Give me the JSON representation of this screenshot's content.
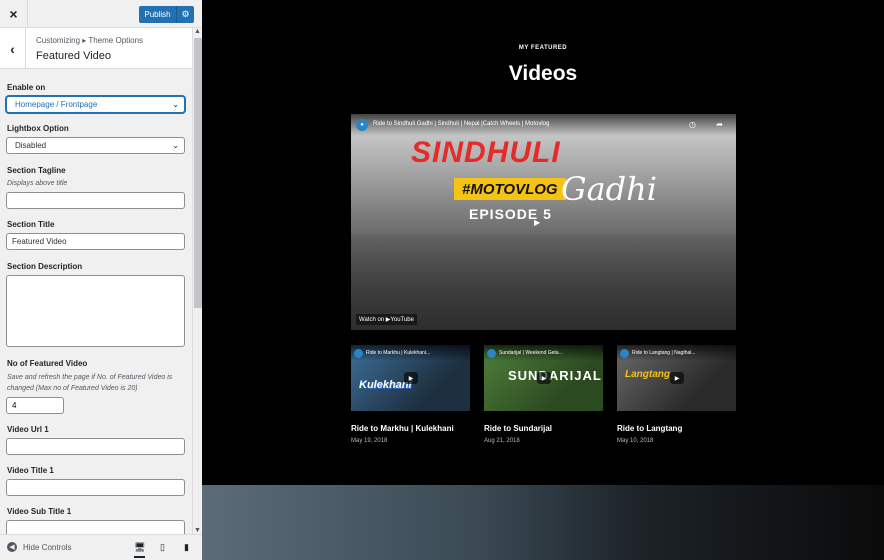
{
  "topbar": {
    "close_icon": "×",
    "publish_label": "Publish",
    "gear_icon": "gear-icon"
  },
  "header": {
    "breadcrumb_a": "Customizing",
    "breadcrumb_sep": "▸",
    "breadcrumb_b": "Theme Options",
    "title": "Featured Video"
  },
  "fields": {
    "enable_on": {
      "label": "Enable on",
      "value": "Homepage / Frontpage"
    },
    "lightbox": {
      "label": "Lightbox Option",
      "value": "Disabled"
    },
    "tagline": {
      "label": "Section Tagline",
      "desc": "Displays above title",
      "value": ""
    },
    "title": {
      "label": "Section Title",
      "value": "Featured Video"
    },
    "description": {
      "label": "Section Description",
      "value": ""
    },
    "count": {
      "label": "No of Featured Video",
      "desc": "Save and refresh the page if No. of Featured Video is changed (Max no of Featured Video is 20)",
      "value": "4"
    },
    "url1": {
      "label": "Video Url 1",
      "value": ""
    },
    "title1": {
      "label": "Video Title 1",
      "value": ""
    },
    "subtitle1": {
      "label": "Video Sub Title 1",
      "value": ""
    }
  },
  "footer": {
    "hide_label": "Hide Controls"
  },
  "preview": {
    "kicker": "MY FEATURED",
    "title": "Videos",
    "main_video": {
      "title": "Ride to Sindhuli Gadhi | Sindhuli | Nepal |Catch Wheels | Motovlog",
      "art_line1": "SINDHULI",
      "art_line2": "#MOTOVLOG",
      "art_line3": "EPISODE 5",
      "art_line4": "Gadhi",
      "watch_on": "Watch on ▶YouTube"
    },
    "videos": [
      {
        "thumb_title": "Ride to Markhu | Kulekhani...",
        "art": "Kulekhani",
        "title": "Ride to Markhu | Kulekhani",
        "date": "May 19, 2018"
      },
      {
        "thumb_title": "Sundarijal | Weekend Geta...",
        "art": "SUNDARIJAL",
        "title": "Ride to Sundarijal",
        "date": "Aug 21, 2018"
      },
      {
        "thumb_title": "Ride to Langtang | Nagthal...",
        "art": "Langtang",
        "title": "Ride to Langtang",
        "date": "May 10, 2018"
      }
    ]
  },
  "colors": {
    "accent": "#2271b1",
    "banner_red": "#e52a2a",
    "banner_yellow": "#f5c316"
  }
}
